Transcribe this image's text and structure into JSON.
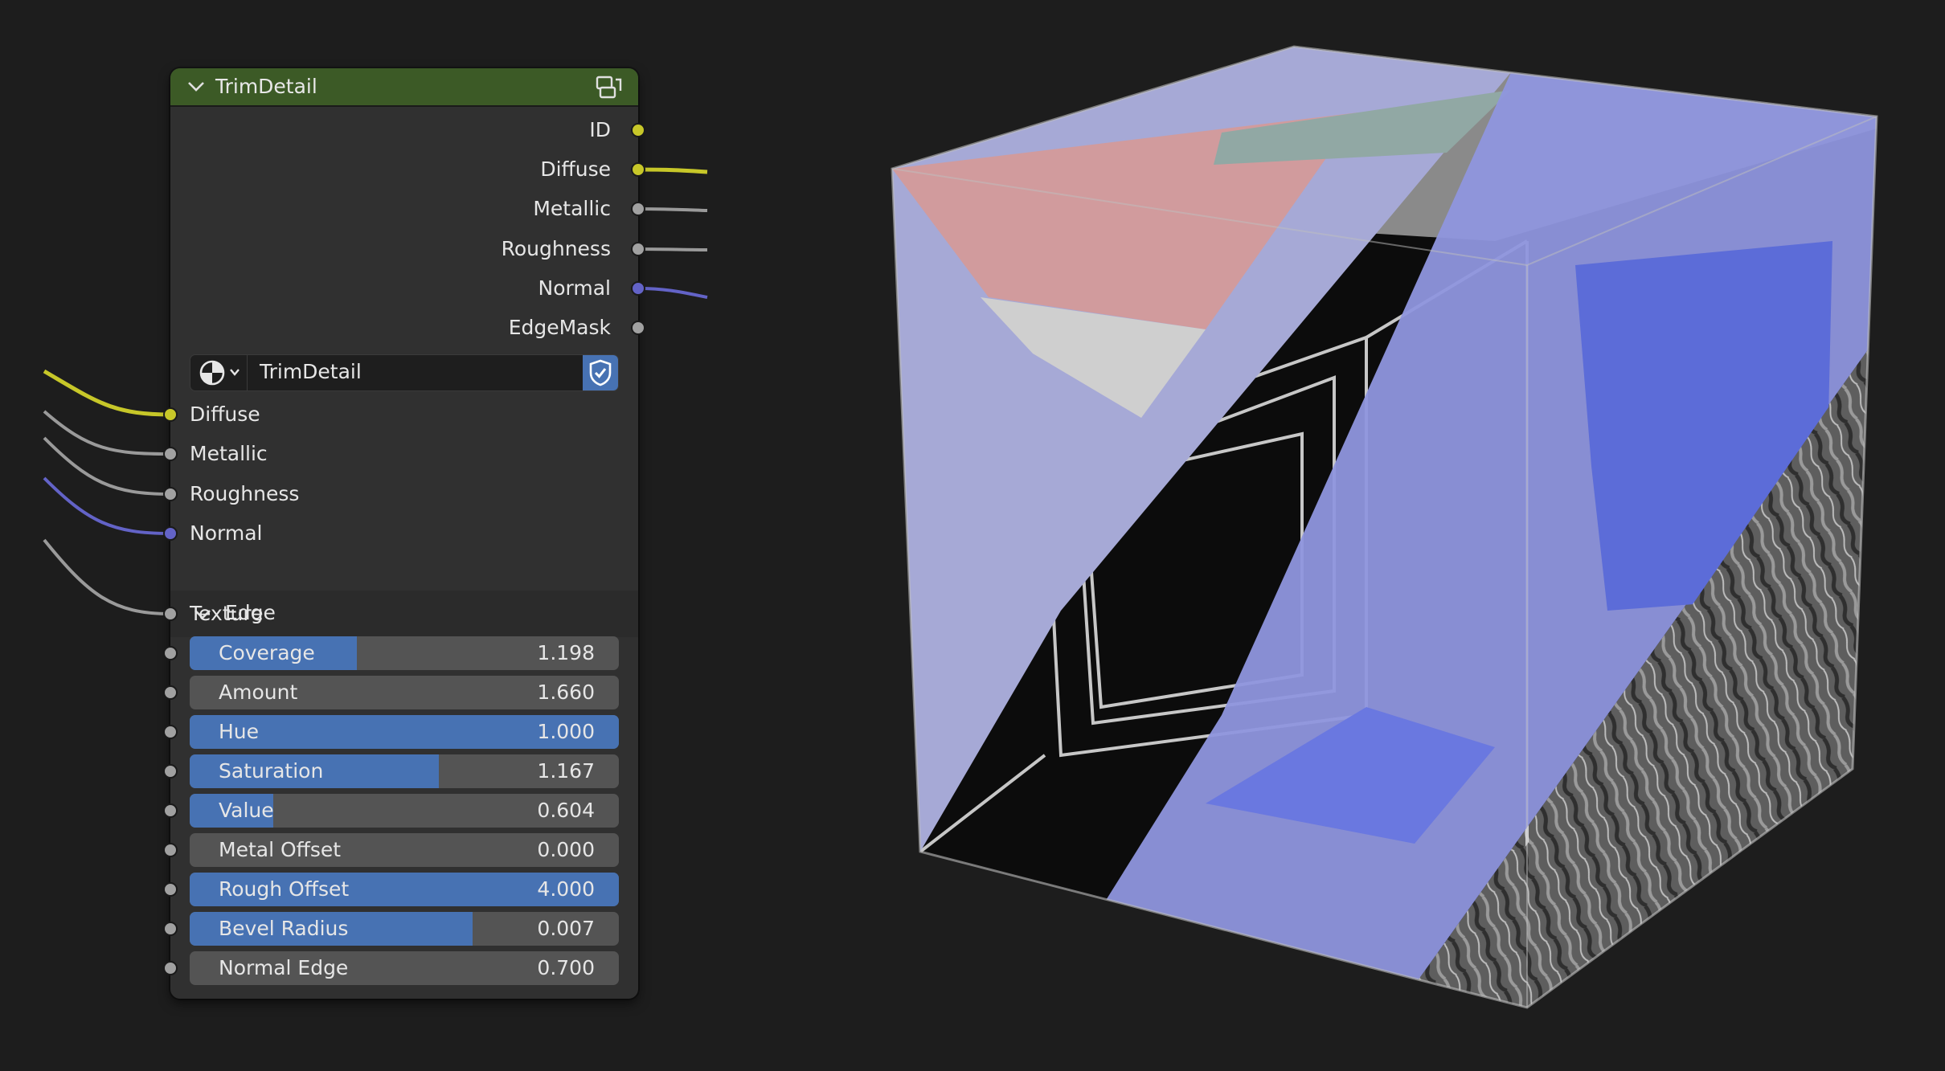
{
  "node": {
    "title": "TrimDetail",
    "header_color": "#3c5a26",
    "header_icon": "node-group-icon",
    "outputs": [
      {
        "label": "ID",
        "socket_color": "#c7c729"
      },
      {
        "label": "Diffuse",
        "socket_color": "#c7c729"
      },
      {
        "label": "Metallic",
        "socket_color": "#a1a1a1"
      },
      {
        "label": "Roughness",
        "socket_color": "#a1a1a1"
      },
      {
        "label": "Normal",
        "socket_color": "#6363c7"
      },
      {
        "label": "EdgeMask",
        "socket_color": "#a1a1a1"
      }
    ],
    "group_selector": {
      "icon": "node-tree-icon",
      "value": "TrimDetail",
      "fake_user_icon": "shield-check-icon"
    },
    "inputs": [
      {
        "label": "Diffuse",
        "socket_color": "#c7c729"
      },
      {
        "label": "Metallic",
        "socket_color": "#a1a1a1"
      },
      {
        "label": "Roughness",
        "socket_color": "#a1a1a1"
      },
      {
        "label": "Normal",
        "socket_color": "#6363c7"
      }
    ],
    "edge_panel": {
      "title": "Edge",
      "texture_label": "Texture",
      "sliders": [
        {
          "label": "Coverage",
          "value": "1.198",
          "fill": 0.39
        },
        {
          "label": "Amount",
          "value": "1.660",
          "fill": 0.0
        },
        {
          "label": "Hue",
          "value": "1.000",
          "fill": 1.0
        },
        {
          "label": "Saturation",
          "value": "1.167",
          "fill": 0.58
        },
        {
          "label": "Value",
          "value": "0.604",
          "fill": 0.195
        },
        {
          "label": "Metal Offset",
          "value": "0.000",
          "fill": 0.0
        },
        {
          "label": "Rough Offset",
          "value": "4.000",
          "fill": 1.0
        },
        {
          "label": "Bevel Radius",
          "value": "0.007",
          "fill": 0.66
        },
        {
          "label": "Normal Edge",
          "value": "0.700",
          "fill": 0.0
        }
      ]
    }
  },
  "colors": {
    "background": "#1d1d1d",
    "node_body": "#303030",
    "slider_fill": "#4772b3",
    "slider_track": "#545454"
  },
  "viewport_object": "textured-cube-preview"
}
